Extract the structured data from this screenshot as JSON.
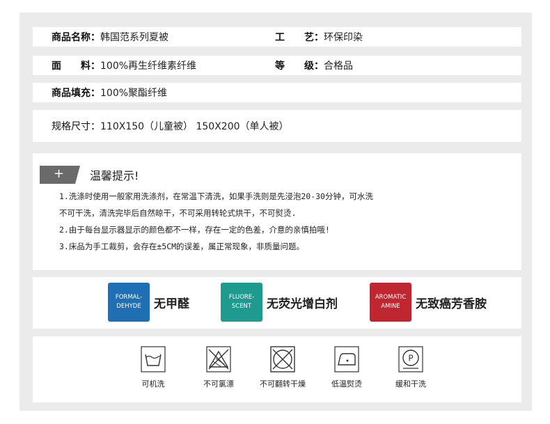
{
  "spec": {
    "name": {
      "label": "商品名称：",
      "value": "韩国范系列夏被"
    },
    "craft": {
      "label": "工　　艺：",
      "value": "环保印染"
    },
    "fabric": {
      "label": "面　　料：",
      "value": "100%再生纤维素纤维"
    },
    "grade": {
      "label": "等　　级：",
      "value": "合格品"
    },
    "filling": {
      "label": "商品填充：",
      "value": "100%聚酯纤维"
    },
    "size": {
      "label": "规格尺寸：",
      "value": "110X150（儿童被） 150X200（单人被）"
    }
  },
  "tips": {
    "tag": "+",
    "title": "温馨提示!",
    "lines": [
      "1.洗涤时使用一般家用洗涤剂，在常温下清洗，如果手洗则是先浸泡20-30分钟，可水洗",
      "不可干洗，清洗完毕后自然晾干，不可采用转轮式烘干，不可熨烫.",
      "2.由于每台显示器显示的颜色都不一样，存在一定的色差，介意的亲慎拍哦!",
      "3.床品为手工裁剪，会存在±5CM的误差，属正常现象，非质量问题。"
    ]
  },
  "features": [
    {
      "badge_line1": "FORMAL-",
      "badge_line2": "DEHYDE",
      "text": "无甲醛",
      "color": "#1f6fb4"
    },
    {
      "badge_line1": "FLUORE-",
      "badge_line2": "SCENT",
      "text": "无荧光增白剂",
      "color": "#1f9a8f"
    },
    {
      "badge_line1": "AROMATIC",
      "badge_line2": "AMINE",
      "text": "无致癌芳香胺",
      "color": "#bf2630"
    }
  ],
  "care": [
    {
      "icon": "machine-wash-icon",
      "label": "可机洗"
    },
    {
      "icon": "no-bleach-icon",
      "label": "不可氯漂"
    },
    {
      "icon": "no-tumble-dry-icon",
      "label": "不可翻转干燥"
    },
    {
      "icon": "low-iron-icon",
      "label": "低温熨烫"
    },
    {
      "icon": "gentle-dry-clean-icon",
      "label": "缓和干洗"
    }
  ]
}
